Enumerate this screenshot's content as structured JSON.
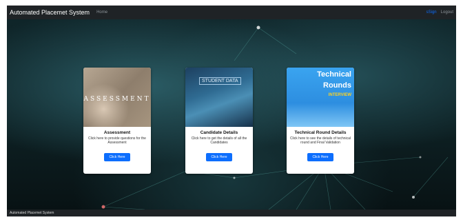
{
  "navbar": {
    "brand": "Automated Placemet System",
    "home_link": "Home",
    "user_link": "sSign",
    "logout_link": "Logout"
  },
  "cards": [
    {
      "image_text": "ASSESSMENT",
      "title": "Assessment",
      "description": "Click here to provide questions for the Assessment",
      "button": "Click Here"
    },
    {
      "image_text": "STUDENT DATA",
      "title": "Candidate Details",
      "description": "Click here to get the details of all the Candidates",
      "button": "Click Here"
    },
    {
      "image_text_line1": "Technical",
      "image_text_line2": "Rounds",
      "image_text_line3": "INTERVIEW",
      "title": "Technical Round Details",
      "description": "Click here to see the details of technical round and Final Validation",
      "button": "Click Here"
    }
  ],
  "footer": {
    "text": "Automated Placemet System"
  },
  "colors": {
    "navbar_bg": "#1f2326",
    "primary_button": "#0d6efd",
    "background_teal": "#2b5d66"
  }
}
